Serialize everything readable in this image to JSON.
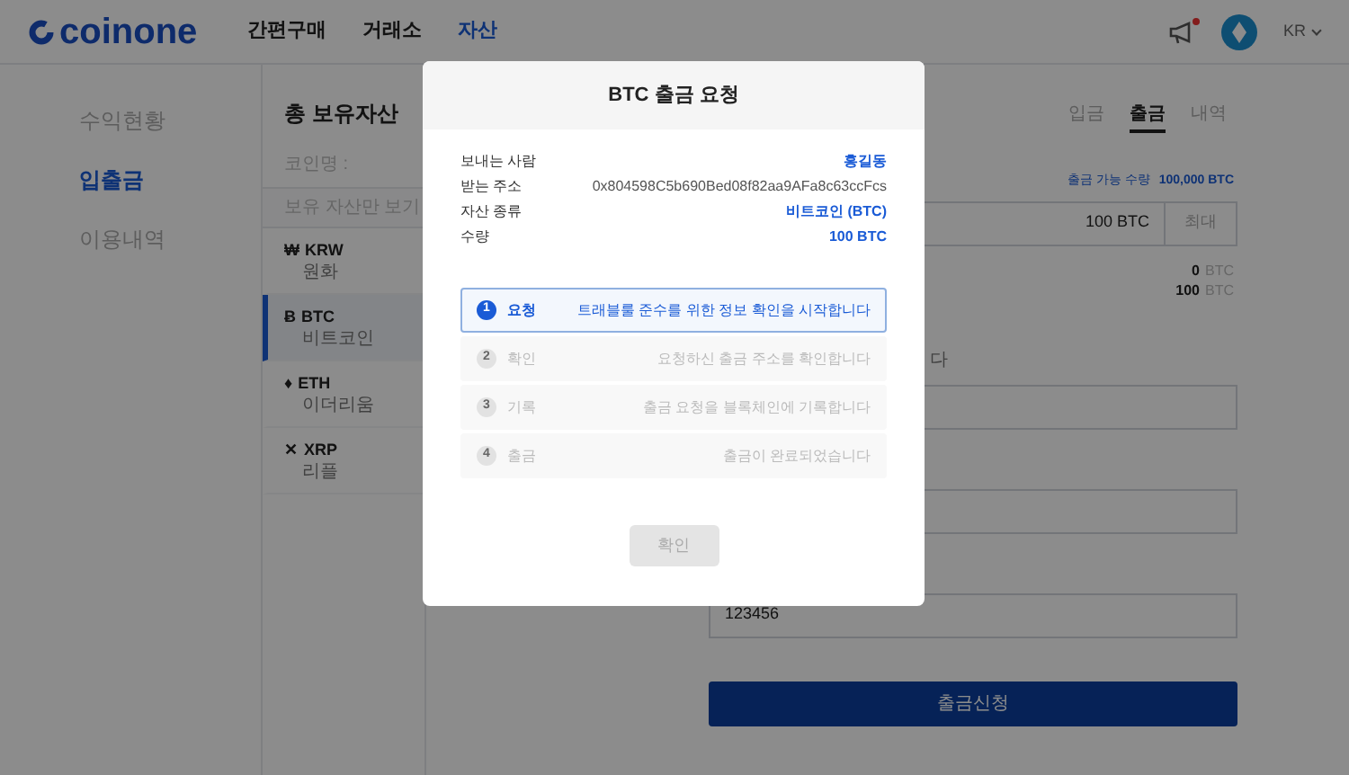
{
  "header": {
    "logo": "coinone",
    "nav": [
      {
        "label": "간편구매",
        "selected": false
      },
      {
        "label": "거래소",
        "selected": false
      },
      {
        "label": "자산",
        "selected": true
      }
    ],
    "notification_dot": true,
    "language": "KR"
  },
  "sidebar": {
    "items": [
      {
        "label": "수익현황",
        "selected": false
      },
      {
        "label": "입출금",
        "selected": true
      },
      {
        "label": "이용내역",
        "selected": false
      }
    ]
  },
  "assets": {
    "title": "총 보유자산",
    "search_label": "코인명 :",
    "filter_label": "보유 자산만 보기",
    "coins": [
      {
        "symbol": "₩",
        "code": "KRW",
        "name": "원화",
        "selected": false
      },
      {
        "symbol": "Ƀ",
        "code": "BTC",
        "name": "비트코인",
        "selected": true
      },
      {
        "symbol": "♦",
        "code": "ETH",
        "name": "이더리움",
        "selected": false
      },
      {
        "symbol": "✕",
        "code": "XRP",
        "name": "리플",
        "selected": false
      }
    ]
  },
  "withdraw_panel": {
    "tabs": [
      {
        "label": "입금",
        "selected": false
      },
      {
        "label": "출금",
        "selected": true
      },
      {
        "label": "내역",
        "selected": false
      }
    ],
    "available_label": "출금 가능 수량",
    "available_value": "100,000 BTC",
    "amount_value": "100 BTC",
    "max_button": "최대",
    "summary": [
      {
        "value": "0",
        "unit": "BTC"
      },
      {
        "value": "100",
        "unit": "BTC"
      }
    ],
    "partial_note": "다",
    "otp_value": "123456",
    "submit_button": "출금신청"
  },
  "modal": {
    "title": "BTC 출금 요청",
    "details": [
      {
        "label": "보내는 사람",
        "value": "홍길동",
        "highlight": true
      },
      {
        "label": "받는 주소",
        "value": "0x804598C5b690Bed08f82aa9AFa8c63ccFcs",
        "highlight": false
      },
      {
        "label": "자산 종류",
        "value": "비트코인 (BTC)",
        "highlight": true
      },
      {
        "label": "수량",
        "value": "100 BTC",
        "highlight": true
      }
    ],
    "steps": [
      {
        "number": "1",
        "title": "요청",
        "description": "트래블룰 준수를 위한 정보 확인을 시작합니다",
        "selected": true
      },
      {
        "number": "2",
        "title": "확인",
        "description": "요청하신 출금 주소를 확인합니다",
        "selected": false
      },
      {
        "number": "3",
        "title": "기록",
        "description": "출금 요청을 블록체인에 기록합니다",
        "selected": false
      },
      {
        "number": "4",
        "title": "출금",
        "description": "출금이 완료되었습니다",
        "selected": false
      }
    ],
    "confirm_button": {
      "label": "확인",
      "disabled": true
    }
  }
}
